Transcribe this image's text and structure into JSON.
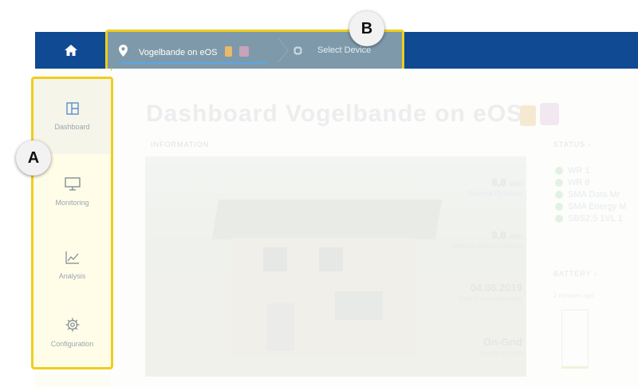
{
  "topbar": {
    "site_label": "Vogelbande on eOS",
    "device_label": "Select Device"
  },
  "sidebar": {
    "items": [
      {
        "label": "Dashboard",
        "icon": "dashboard-icon"
      },
      {
        "label": "Monitoring",
        "icon": "monitor-icon"
      },
      {
        "label": "Analysis",
        "icon": "chart-icon"
      },
      {
        "label": "Configuration",
        "icon": "gear-icon"
      }
    ]
  },
  "main": {
    "title": "Dashboard Vogelbande on eOS",
    "info_label": "INFORMATION",
    "stats": [
      {
        "value": "8,8",
        "unit": "kWp",
        "label": "Nominal PV power"
      },
      {
        "value": "9,8",
        "unit": "kWh",
        "label": "Nominal battery capacity"
      },
      {
        "value": "04.06.2019",
        "unit": "",
        "label": "Date of commissioning"
      },
      {
        "value": "On-Grid",
        "unit": "",
        "label": "Operating mode"
      }
    ],
    "status_label": "STATUS",
    "status_items": [
      "WR 1",
      "WR 8",
      "SMA Data Mr",
      "SMA Energy M",
      "SBS2.5 1VL 1"
    ],
    "battery_label": "BATTERY",
    "battery_time": "2 minutes ago"
  },
  "callouts": {
    "a": "A",
    "b": "B"
  },
  "colors": {
    "topbar": "#0f4a93",
    "highlight": "#f0cd1e",
    "breadcrumb_bg": "#7e9aaa"
  }
}
